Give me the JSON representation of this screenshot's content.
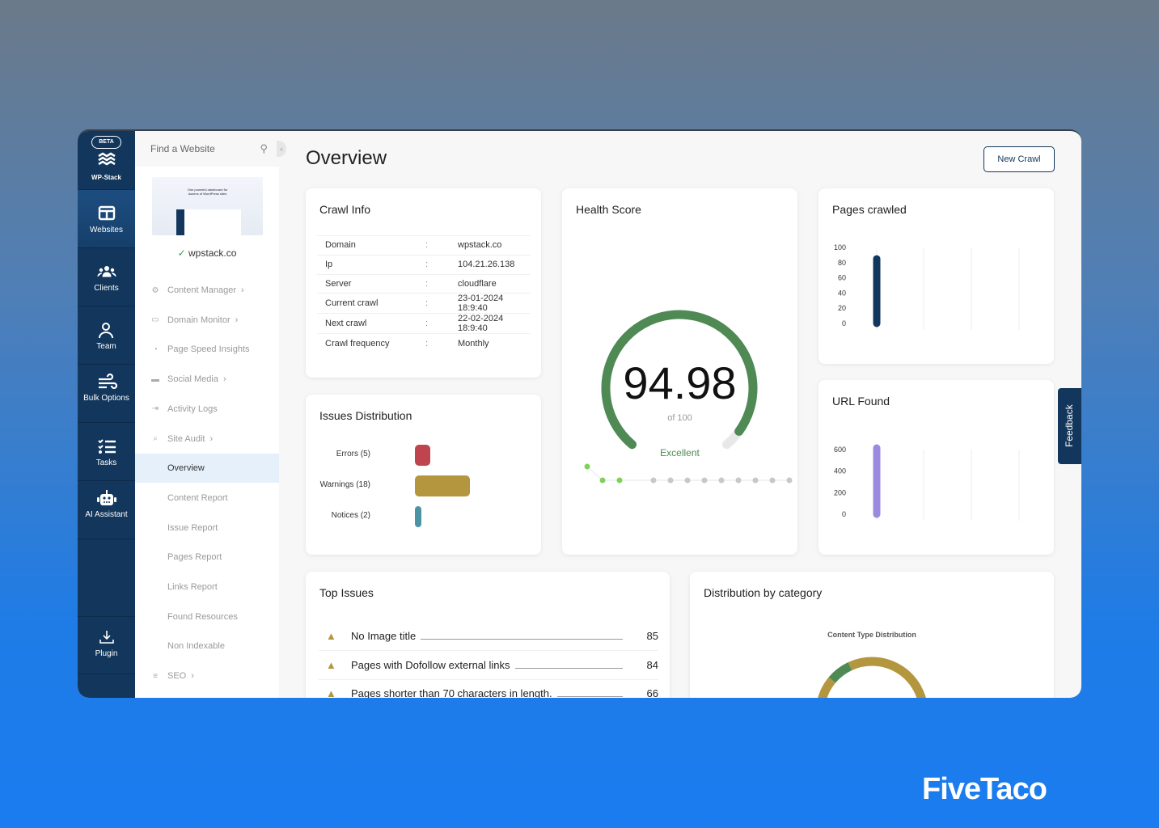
{
  "rail": {
    "beta": "BETA",
    "logo": "WP-Stack",
    "items": [
      {
        "label": "Websites",
        "icon": "browser-icon"
      },
      {
        "label": "Clients",
        "icon": "users-icon"
      },
      {
        "label": "Team",
        "icon": "team-icon"
      },
      {
        "label": "Bulk Options",
        "icon": "wind-icon"
      },
      {
        "label": "Tasks",
        "icon": "checklist-icon"
      },
      {
        "label": "AI Assistant",
        "icon": "robot-icon"
      },
      {
        "label": "Plugin",
        "icon": "download-icon"
      }
    ]
  },
  "sub": {
    "search_placeholder": "Find a Website",
    "site": "wpstack.co",
    "thumb_heading": "One powerful dashboard for dozens of WordPress sites",
    "menu": [
      {
        "label": "Content Manager",
        "icon": "gear-icon",
        "chev": true
      },
      {
        "label": "Domain Monitor",
        "icon": "monitor-icon",
        "chev": true
      },
      {
        "label": "Page Speed Insights",
        "icon": "speedometer-icon"
      },
      {
        "label": "Social Media",
        "icon": "chat-icon",
        "chev": true
      },
      {
        "label": "Activity Logs",
        "icon": "login-icon"
      },
      {
        "label": "Site Audit",
        "icon": "clipboard-search-icon",
        "chev": true
      }
    ],
    "audit": [
      "Overview",
      "Content Report",
      "Issue Report",
      "Pages Report",
      "Links Report",
      "Found Resources",
      "Non Indexable"
    ],
    "seo": "SEO"
  },
  "main": {
    "title": "Overview",
    "new_crawl": "New Crawl",
    "crawl_info": {
      "title": "Crawl Info",
      "rows": [
        [
          "Domain",
          "wpstack.co"
        ],
        [
          "Ip",
          "104.21.26.138"
        ],
        [
          "Server",
          "cloudflare"
        ],
        [
          "Current crawl",
          "23-01-2024 18:9:40"
        ],
        [
          "Next crawl",
          "22-02-2024 18:9:40"
        ],
        [
          "Crawl frequency",
          "Monthly"
        ]
      ]
    },
    "issues": {
      "title": "Issues Distribution",
      "items": [
        {
          "label": "Errors (5)",
          "value": 5,
          "color": "#c0444d"
        },
        {
          "label": "Warnings (18)",
          "value": 18,
          "color": "#b3963e"
        },
        {
          "label": "Notices (2)",
          "value": 2,
          "color": "#4a94a4"
        }
      ]
    },
    "health": {
      "title": "Health Score",
      "score": "94.98",
      "of": "of 100",
      "value": 94.98,
      "max": 100,
      "rating": "Excellent",
      "color": "#4f8a55"
    },
    "pages_crawled": {
      "title": "Pages crawled",
      "ticks": [
        "100",
        "80",
        "60",
        "40",
        "20",
        "0"
      ],
      "value": 85,
      "max": 100,
      "color": "#12365c"
    },
    "url_found": {
      "title": "URL Found",
      "ticks": [
        "600",
        "400",
        "200",
        "0"
      ],
      "value": 650,
      "max": 700,
      "color": "#9b8ae0"
    },
    "top_issues": {
      "title": "Top Issues",
      "items": [
        {
          "label": "No Image title",
          "count": "85"
        },
        {
          "label": "Pages with Dofollow external links",
          "count": "84"
        },
        {
          "label": "Pages shorter than 70 characters in length.",
          "count": "66"
        }
      ]
    },
    "distribution": {
      "title": "Distribution by category",
      "chart_title": "Content Type Distribution",
      "segments": [
        {
          "value": 93,
          "color": "#b3963e"
        },
        {
          "value": 7,
          "color": "#4f8a55"
        }
      ]
    }
  },
  "feedback": "Feedback",
  "brand": "FiveTaco"
}
